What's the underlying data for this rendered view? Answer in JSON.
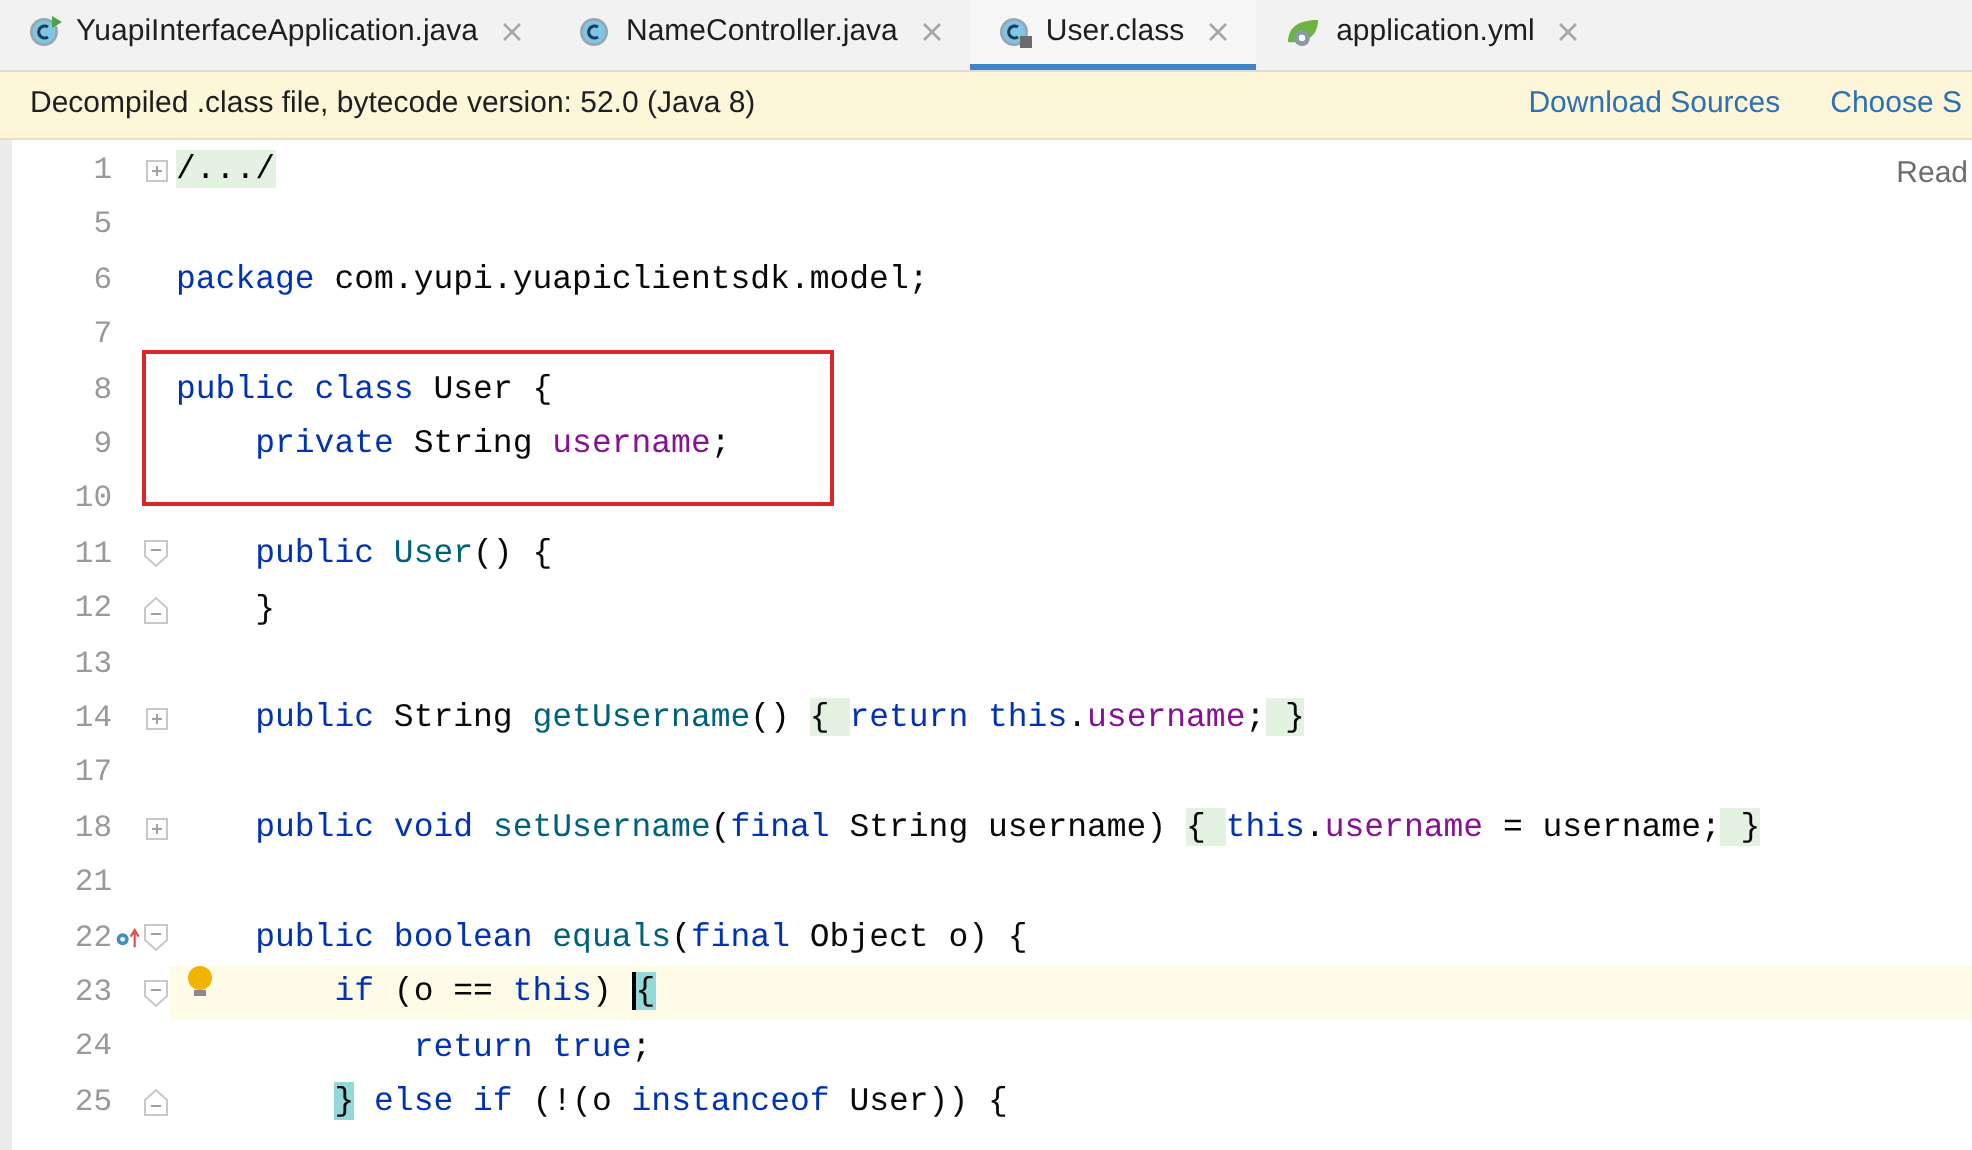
{
  "tabs": [
    {
      "label": "YuapiInterfaceApplication.java",
      "kind": "runnable",
      "selected": false
    },
    {
      "label": "NameController.java",
      "kind": "class",
      "selected": false
    },
    {
      "label": "User.class",
      "kind": "compiled",
      "selected": true
    },
    {
      "label": "application.yml",
      "kind": "config",
      "selected": false
    }
  ],
  "banner": {
    "message": "Decompiled .class file, bytecode version: 52.0 (Java 8)",
    "links": [
      "Download Sources",
      "Choose S"
    ]
  },
  "reader_mode": "Read",
  "lines": [
    {
      "number": "1",
      "kind": "collapsed",
      "tokens": [
        {
          "kind": "folded",
          "text": "/.../"
        }
      ]
    },
    {
      "number": "5"
    },
    {
      "number": "6",
      "tokens": [
        {
          "kind": "kw",
          "text": "package "
        },
        {
          "kind": "id",
          "text": "com.yupi.yuapiclientsdk.model;"
        }
      ]
    },
    {
      "number": "7"
    },
    {
      "number": "8",
      "tokens": [
        {
          "kind": "kw",
          "text": "public class "
        },
        {
          "kind": "id",
          "text": "User {"
        }
      ]
    },
    {
      "number": "9",
      "tokens": [
        {
          "kind": "kw",
          "text": "    private "
        },
        {
          "kind": "id",
          "text": "String "
        },
        {
          "kind": "field",
          "text": "username"
        },
        {
          "kind": "id",
          "text": ";"
        }
      ]
    },
    {
      "number": "10"
    },
    {
      "number": "11",
      "kind": "foldstart",
      "tokens": [
        {
          "kind": "kw",
          "text": "    public "
        },
        {
          "kind": "fn",
          "text": "User"
        },
        {
          "kind": "id",
          "text": "() {"
        }
      ]
    },
    {
      "number": "12",
      "kind": "foldend",
      "tokens": [
        {
          "kind": "id",
          "text": "    }"
        }
      ]
    },
    {
      "number": "13"
    },
    {
      "number": "14",
      "kind": "collapsed",
      "tokens": [
        {
          "kind": "kw",
          "text": "    public "
        },
        {
          "kind": "id",
          "text": "String "
        },
        {
          "kind": "fn",
          "text": "getUsername"
        },
        {
          "kind": "id",
          "text": "() "
        },
        {
          "kind": "folded",
          "text": "{ "
        },
        {
          "kind": "kw",
          "text": "return this"
        },
        {
          "kind": "id",
          "text": "."
        },
        {
          "kind": "field",
          "text": "username"
        },
        {
          "kind": "id",
          "text": ";"
        },
        {
          "kind": "folded",
          "text": " }"
        }
      ]
    },
    {
      "number": "17"
    },
    {
      "number": "18",
      "kind": "collapsed",
      "tokens": [
        {
          "kind": "kw",
          "text": "    public void "
        },
        {
          "kind": "fn",
          "text": "setUsername"
        },
        {
          "kind": "id",
          "text": "("
        },
        {
          "kind": "kw",
          "text": "final "
        },
        {
          "kind": "id",
          "text": "String username) "
        },
        {
          "kind": "folded",
          "text": "{ "
        },
        {
          "kind": "kw",
          "text": "this"
        },
        {
          "kind": "id",
          "text": "."
        },
        {
          "kind": "field",
          "text": "username"
        },
        {
          "kind": "id",
          "text": " = username;"
        },
        {
          "kind": "folded",
          "text": " }"
        }
      ]
    },
    {
      "number": "21"
    },
    {
      "number": "22",
      "kind": "override",
      "tokens": [
        {
          "kind": "kw",
          "text": "    public boolean "
        },
        {
          "kind": "fn",
          "text": "equals"
        },
        {
          "kind": "id",
          "text": "("
        },
        {
          "kind": "kw",
          "text": "final "
        },
        {
          "kind": "id",
          "text": "Object o) {"
        }
      ]
    },
    {
      "number": "23",
      "kind": "foldstart",
      "current": true,
      "tokens": [
        {
          "kind": "kw",
          "text": "        if "
        },
        {
          "kind": "id",
          "text": "(o == "
        },
        {
          "kind": "kw",
          "text": "this"
        },
        {
          "kind": "id",
          "text": ") "
        },
        {
          "kind": "caret",
          "text": "{"
        }
      ]
    },
    {
      "number": "24",
      "tokens": [
        {
          "kind": "kw",
          "text": "            return true"
        },
        {
          "kind": "id",
          "text": ";"
        }
      ]
    },
    {
      "number": "25",
      "kind": "foldend",
      "tokens": [
        {
          "kind": "match",
          "text": "        }"
        },
        {
          "kind": "kw",
          "text": " else if "
        },
        {
          "kind": "id",
          "text": "(!(o "
        },
        {
          "kind": "kw",
          "text": "instanceof "
        },
        {
          "kind": "id",
          "text": "User)) {"
        }
      ]
    }
  ]
}
